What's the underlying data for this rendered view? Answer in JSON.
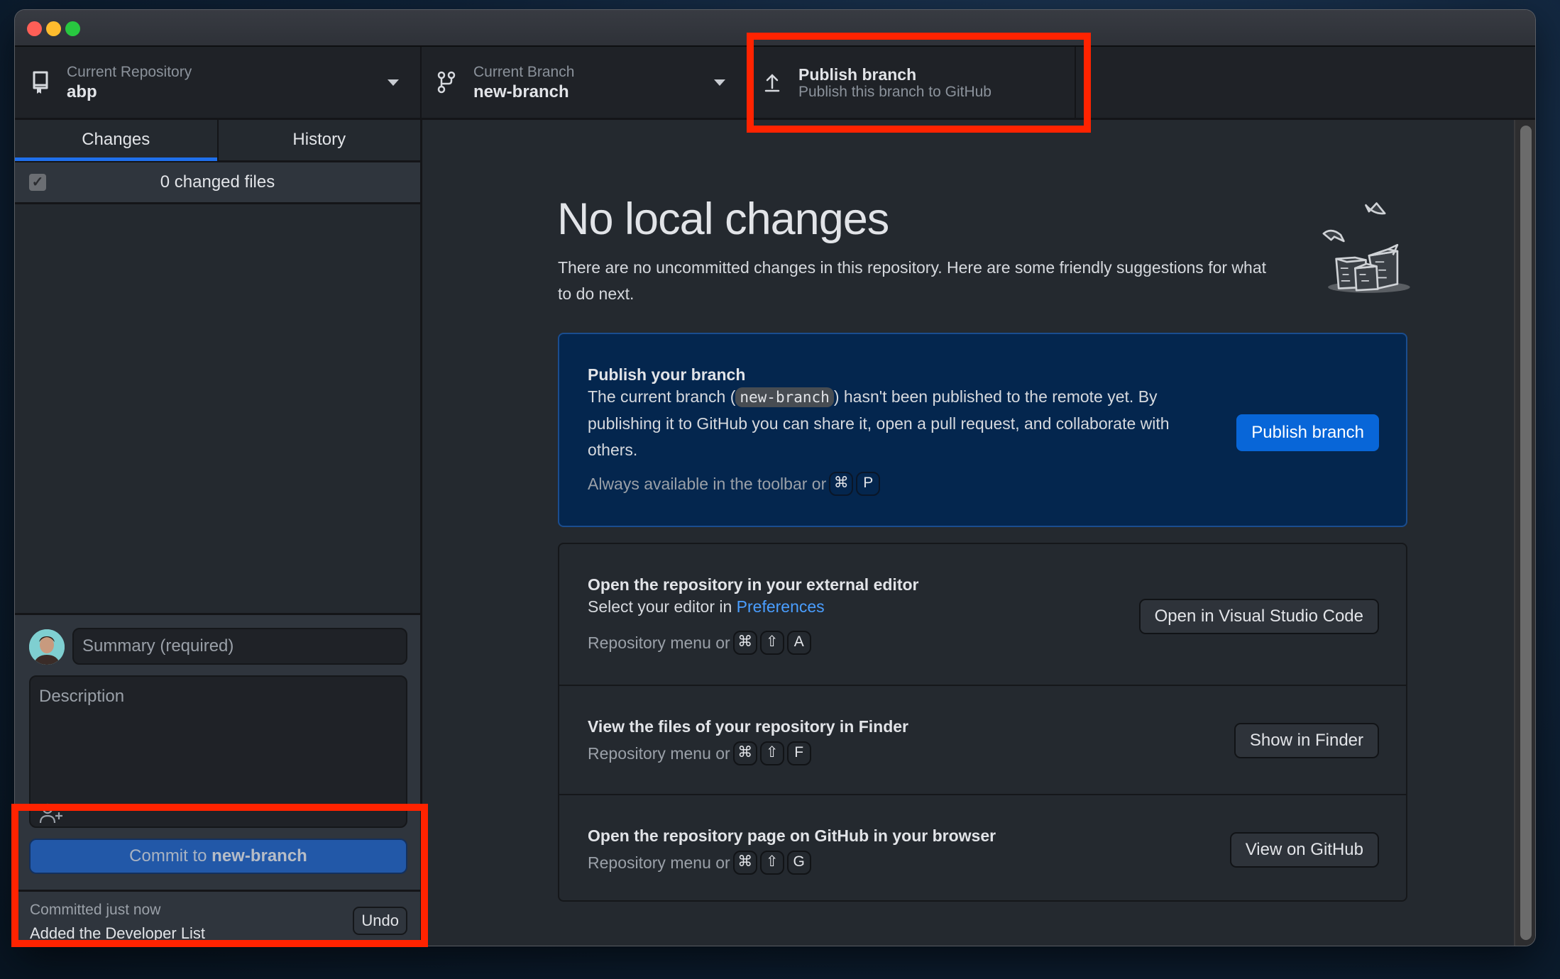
{
  "window": {
    "traffic_lights": [
      "close",
      "minimize",
      "zoom"
    ]
  },
  "toolbar": {
    "repository": {
      "label": "Current Repository",
      "value": "abp",
      "icon": "repo-icon"
    },
    "branch": {
      "label": "Current Branch",
      "value": "new-branch",
      "icon": "branch-icon"
    },
    "publish": {
      "title": "Publish branch",
      "subtitle": "Publish this branch to GitHub",
      "icon": "upload-arrow-icon"
    }
  },
  "sidebar": {
    "tabs": [
      {
        "label": "Changes",
        "active": true
      },
      {
        "label": "History",
        "active": false
      }
    ],
    "changed_files": "0 changed files",
    "commit": {
      "summary_placeholder": "Summary (required)",
      "description_placeholder": "Description",
      "button_prefix": "Commit to ",
      "button_branch": "new-branch"
    },
    "last_commit": {
      "time": "Committed just now",
      "message": "Added the Developer List",
      "undo_label": "Undo"
    }
  },
  "main": {
    "heading": "No local changes",
    "subtext": "There are no uncommitted changes in this repository. Here are some friendly suggestions for what to do next.",
    "publish_card": {
      "title": "Publish your branch",
      "text_before": "The current branch (",
      "branch_code": "new-branch",
      "text_after": ") hasn't been published to the remote yet. By publishing it to GitHub you can share it, open a pull request, and collaborate with others.",
      "hint": "Always available in the toolbar or",
      "keys": [
        "⌘",
        "P"
      ],
      "button": "Publish branch"
    },
    "editor_row": {
      "title": "Open the repository in your external editor",
      "text": "Select your editor in ",
      "link": "Preferences",
      "hint": "Repository menu or",
      "keys": [
        "⌘",
        "⇧",
        "A"
      ],
      "button": "Open in Visual Studio Code"
    },
    "finder_row": {
      "title": "View the files of your repository in Finder",
      "hint": "Repository menu or",
      "keys": [
        "⌘",
        "⇧",
        "F"
      ],
      "button": "Show in Finder"
    },
    "github_row": {
      "title": "Open the repository page on GitHub in your browser",
      "hint": "Repository menu or",
      "keys": [
        "⌘",
        "⇧",
        "G"
      ],
      "button": "View on GitHub"
    }
  },
  "colors": {
    "accent": "#1f6feb",
    "publish_button": "#0866d8",
    "publish_card_bg": "#04264e",
    "highlight": "#ff2300",
    "link": "#4a9eff"
  }
}
